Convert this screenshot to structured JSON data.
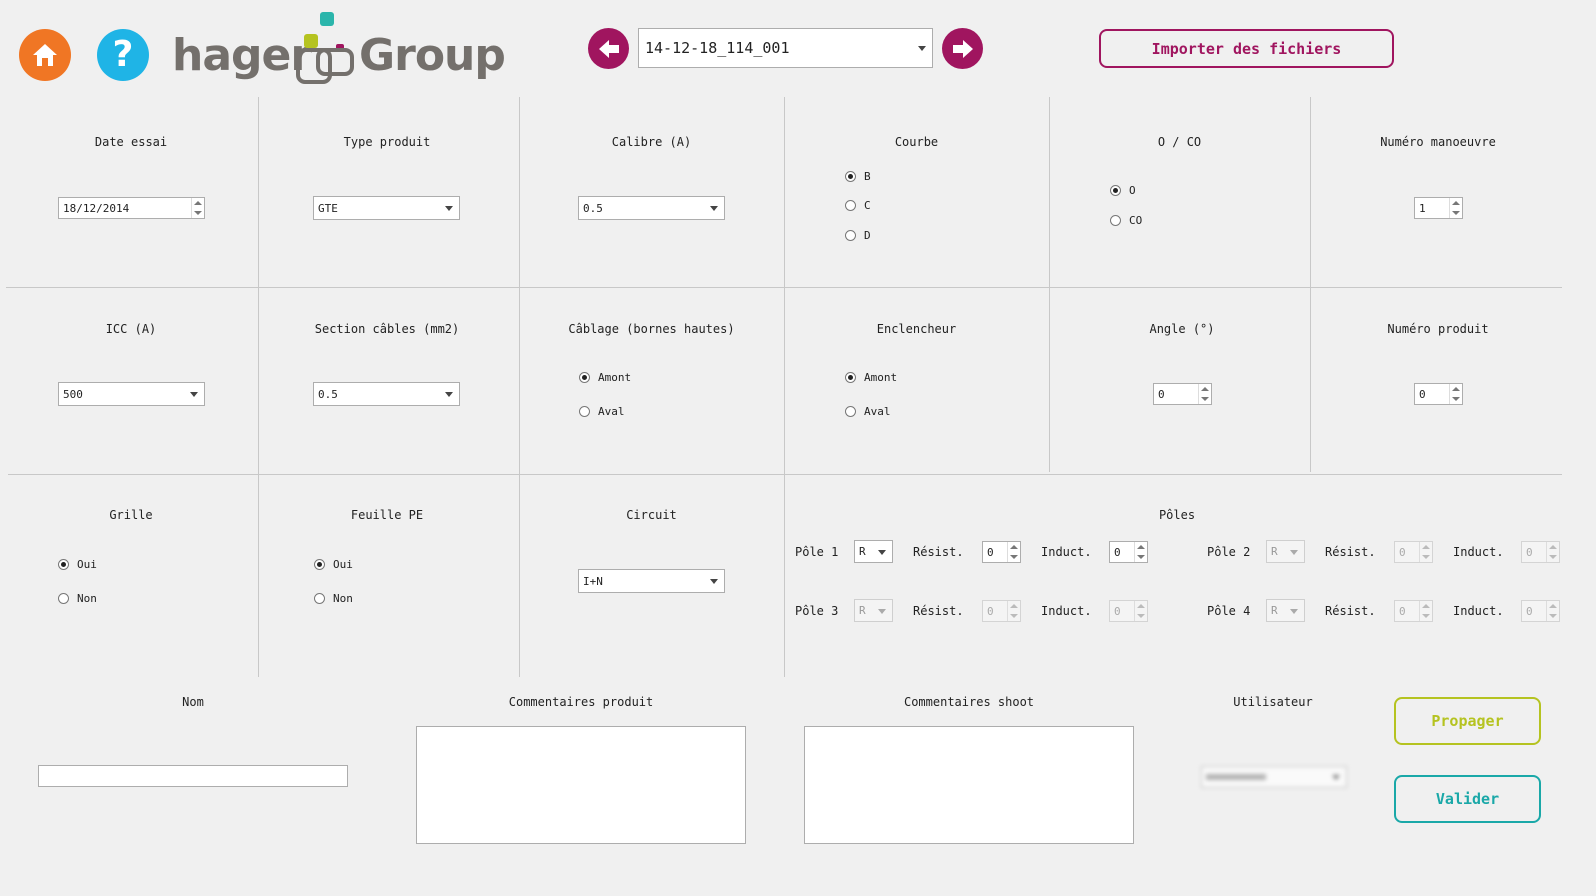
{
  "header": {
    "file_selector": {
      "value": "14-12-18_114_001"
    },
    "import_button": "Importer des fichiers",
    "logo": {
      "word1": "hager",
      "word2": "Group"
    },
    "colors": {
      "home": "#f07624",
      "help": "#1fb4e6",
      "nav": "#a0155f",
      "logo_teal": "#2bb5ab",
      "logo_lime": "#b5c320",
      "logo_magenta": "#a0155f",
      "logo_gray": "#74706c"
    }
  },
  "row1": {
    "date": {
      "label": "Date essai",
      "value": "18/12/2014"
    },
    "type": {
      "label": "Type produit",
      "value": "GTE"
    },
    "calibre": {
      "label": "Calibre (A)",
      "value": "0.5"
    },
    "courbe": {
      "label": "Courbe",
      "options": [
        "B",
        "C",
        "D"
      ],
      "selected": "B"
    },
    "oco": {
      "label": "O / CO",
      "options": [
        "O",
        "CO"
      ],
      "selected": "O"
    },
    "manoeuvre": {
      "label": "Numéro manoeuvre",
      "value": "1"
    }
  },
  "row2": {
    "icc": {
      "label": "ICC (A)",
      "value": "500"
    },
    "section": {
      "label": "Section câbles (mm2)",
      "value": "0.5"
    },
    "cablage": {
      "label": "Câblage (bornes hautes)",
      "options": [
        "Amont",
        "Aval"
      ],
      "selected": "Amont"
    },
    "enclencheur": {
      "label": "Enclencheur",
      "options": [
        "Amont",
        "Aval"
      ],
      "selected": "Amont"
    },
    "angle": {
      "label": "Angle (°)",
      "value": "0"
    },
    "produit": {
      "label": "Numéro produit",
      "value": "0"
    }
  },
  "row3": {
    "grille": {
      "label": "Grille",
      "options": [
        "Oui",
        "Non"
      ],
      "selected": "Oui"
    },
    "feuille": {
      "label": "Feuille PE",
      "options": [
        "Oui",
        "Non"
      ],
      "selected": "Oui"
    },
    "circuit": {
      "label": "Circuit",
      "value": "I+N"
    },
    "poles": {
      "label": "Pôles",
      "resist_label": "Résist.",
      "induct_label": "Induct.",
      "items": [
        {
          "name": "Pôle 1",
          "phase": "R",
          "resist": "0",
          "induct": "0"
        },
        {
          "name": "Pôle 2",
          "phase": "R",
          "resist": "0",
          "induct": "0"
        },
        {
          "name": "Pôle 3",
          "phase": "R",
          "resist": "0",
          "induct": "0"
        },
        {
          "name": "Pôle 4",
          "phase": "R",
          "resist": "0",
          "induct": "0"
        }
      ]
    }
  },
  "bottom": {
    "nom": {
      "label": "Nom",
      "value": ""
    },
    "comm_produit": {
      "label": "Commentaires produit",
      "value": ""
    },
    "comm_shoot": {
      "label": "Commentaires shoot",
      "value": ""
    },
    "utilisateur": {
      "label": "Utilisateur"
    },
    "propager": "Propager",
    "valider": "Valider",
    "colors": {
      "propager": "#b5c320",
      "valider": "#1aa8a8"
    }
  }
}
